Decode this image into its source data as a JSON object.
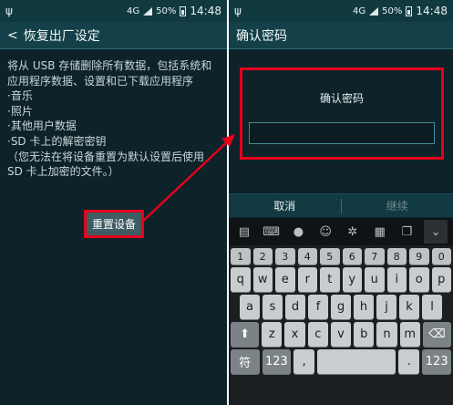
{
  "left": {
    "status": {
      "network": "4G",
      "battery": "50%",
      "time": "14:48"
    },
    "title": "恢复出厂设定",
    "body": [
      "将从 USB 存储删除所有数据，包括系统和应用程序数据、设置和已下载应用程序",
      "·音乐",
      "·照片",
      "·其他用户数据",
      "·SD 卡上的解密密钥",
      "（您无法在将设备重置为默认设置后使用 SD 卡上加密的文件。）"
    ],
    "reset_button": "重置设备"
  },
  "right": {
    "status": {
      "network": "4G",
      "battery": "50%",
      "time": "14:48"
    },
    "title": "确认密码",
    "dialog_title": "确认密码",
    "cancel": "取消",
    "continue": "继续",
    "keyboard": {
      "toolbar": [
        "clipboard-icon",
        "keyboard-icon",
        "mic-icon",
        "emoji-icon",
        "gear-icon",
        "template-icon",
        "copy-icon",
        "chevron-down-icon"
      ],
      "numbers": [
        "1",
        "2",
        "3",
        "4",
        "5",
        "6",
        "7",
        "8",
        "9",
        "0"
      ],
      "row1": [
        "q",
        "w",
        "e",
        "r",
        "t",
        "y",
        "u",
        "i",
        "o",
        "p"
      ],
      "row2": [
        "a",
        "s",
        "d",
        "f",
        "g",
        "h",
        "j",
        "k",
        "l"
      ],
      "row3": [
        "z",
        "x",
        "c",
        "v",
        "b",
        "n",
        "m"
      ],
      "bottom": [
        "符",
        "123",
        ",",
        ".",
        "123"
      ]
    }
  },
  "colors": {
    "highlight": "#e8001c",
    "screen_bg": "#0d2229"
  }
}
